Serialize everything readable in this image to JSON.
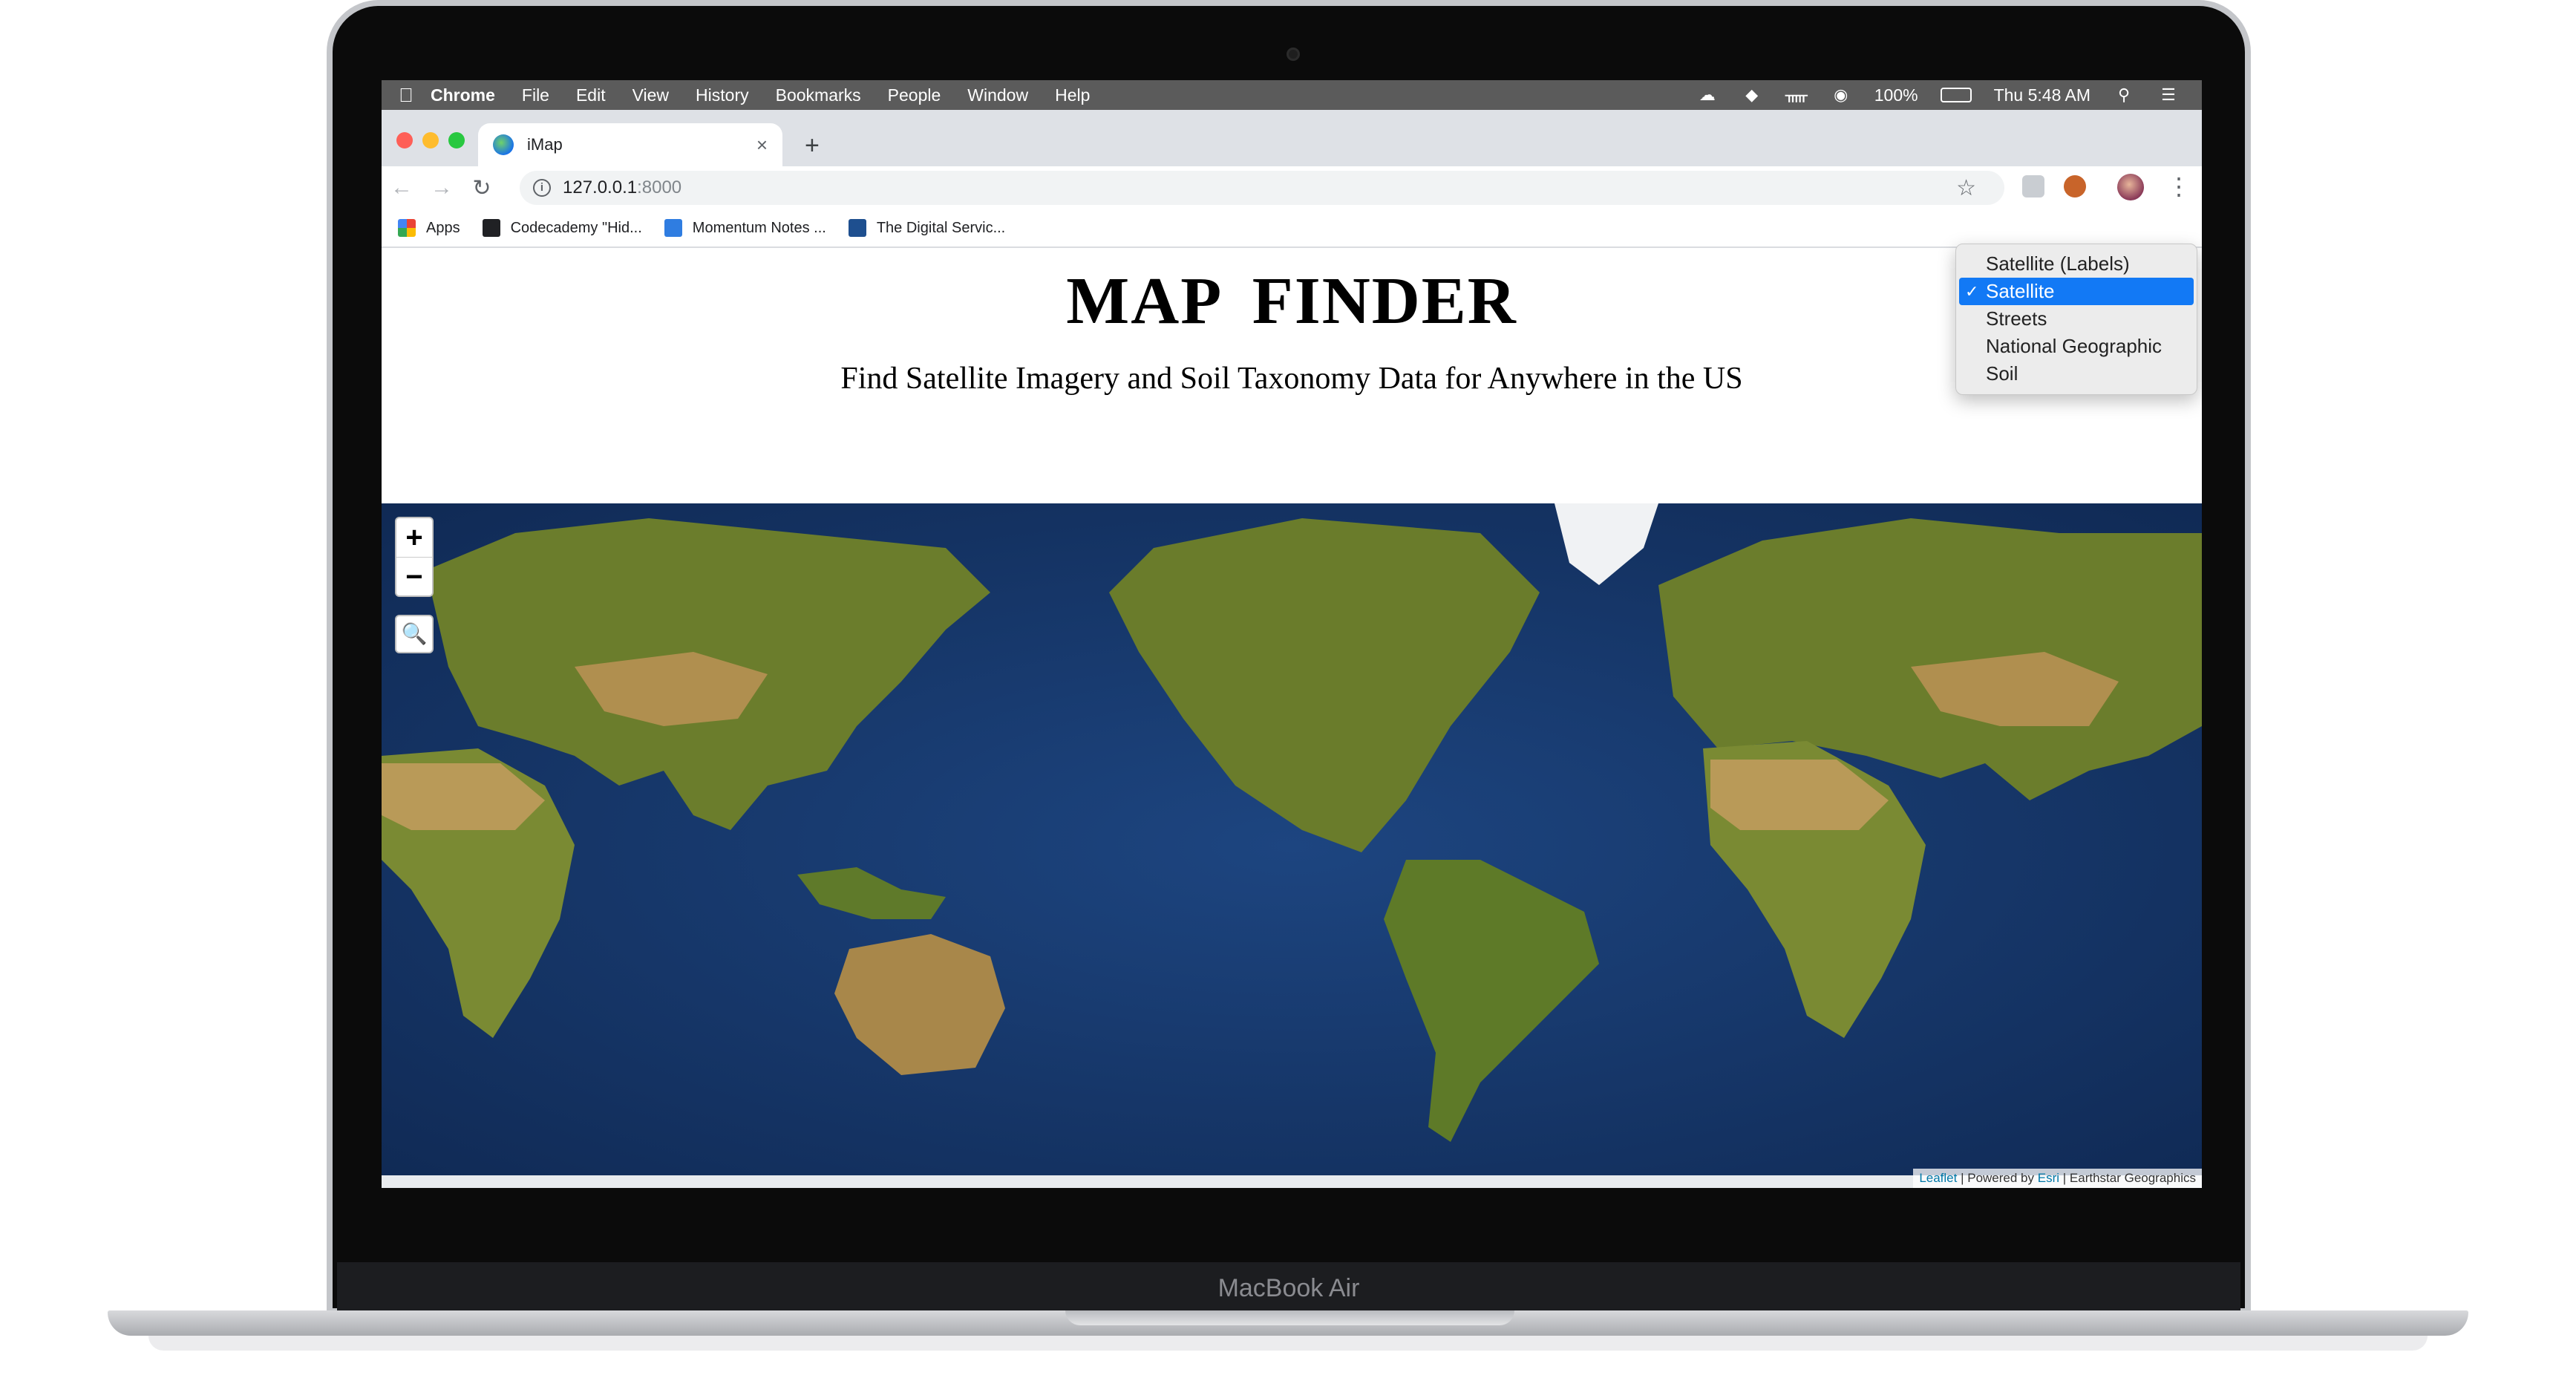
{
  "device": {
    "label": "MacBook Air"
  },
  "menubar": {
    "items": [
      "Chrome",
      "File",
      "Edit",
      "View",
      "History",
      "Bookmarks",
      "People",
      "Window",
      "Help"
    ],
    "battery": "100%",
    "clock": "Thu 5:48 AM"
  },
  "tab": {
    "title": "iMap"
  },
  "address_bar": {
    "host": "127.0.0.1",
    "port": ":8000"
  },
  "bookmarks": [
    "Apps",
    "Codecademy \"Hid...",
    "Momentum Notes ...",
    "The Digital Servic..."
  ],
  "page": {
    "title": "MAP  FINDER",
    "subtitle": "Find Satellite Imagery and Soil Taxonomy Data for Anywhere in the US"
  },
  "basemap_select": {
    "options": [
      "Satellite (Labels)",
      "Satellite",
      "Streets",
      "National Geographic",
      "Soil"
    ],
    "selected": "Satellite",
    "check_mark": "✓"
  },
  "map": {
    "zoom_in": "+",
    "zoom_out": "−",
    "attribution": {
      "leaflet": "Leaflet",
      "powered_by": "| Powered by",
      "esri": "Esri",
      "source": "| Earthstar Geographics"
    },
    "colors": {
      "ocean": "#15325f",
      "land": "#6f7f2f",
      "desert": "#b29452",
      "ice": "#f2f4f6"
    }
  }
}
